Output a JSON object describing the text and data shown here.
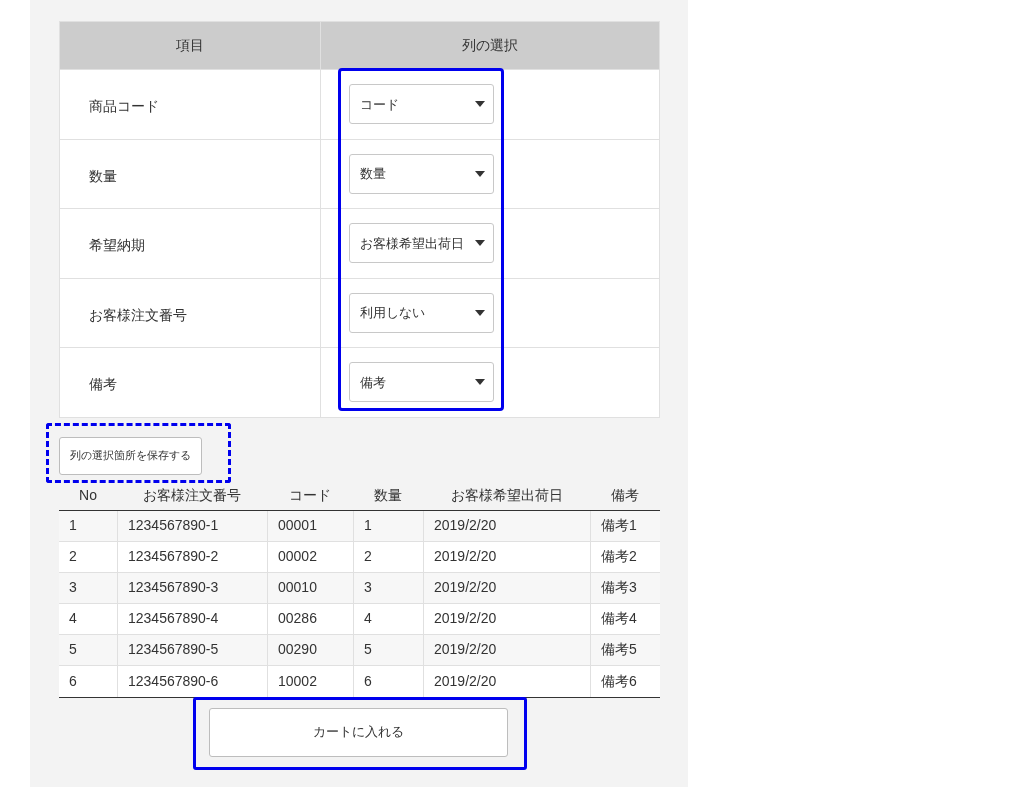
{
  "mapping_table": {
    "columns": [
      "項目",
      "列の選択"
    ],
    "rows": [
      {
        "item": "商品コード",
        "selection": "コード"
      },
      {
        "item": "数量",
        "selection": "数量"
      },
      {
        "item": "希望納期",
        "selection": "お客様希望出荷日"
      },
      {
        "item": "お客様注文番号",
        "selection": "利用しない"
      },
      {
        "item": "備考",
        "selection": "備考"
      }
    ]
  },
  "save_button": "列の選択箇所を保存する",
  "preview_table": {
    "columns": [
      "No",
      "お客様注文番号",
      "コード",
      "数量",
      "お客様希望出荷日",
      "備考"
    ],
    "rows": [
      [
        "1",
        "1234567890-1",
        "00001",
        "1",
        "2019/2/20",
        "備考1"
      ],
      [
        "2",
        "1234567890-2",
        "00002",
        "2",
        "2019/2/20",
        "備考2"
      ],
      [
        "3",
        "1234567890-3",
        "00010",
        "3",
        "2019/2/20",
        "備考3"
      ],
      [
        "4",
        "1234567890-4",
        "00286",
        "4",
        "2019/2/20",
        "備考4"
      ],
      [
        "5",
        "1234567890-5",
        "00290",
        "5",
        "2019/2/20",
        "備考5"
      ],
      [
        "6",
        "1234567890-6",
        "10002",
        "6",
        "2019/2/20",
        "備考6"
      ]
    ]
  },
  "cart_button": "カートに入れる"
}
